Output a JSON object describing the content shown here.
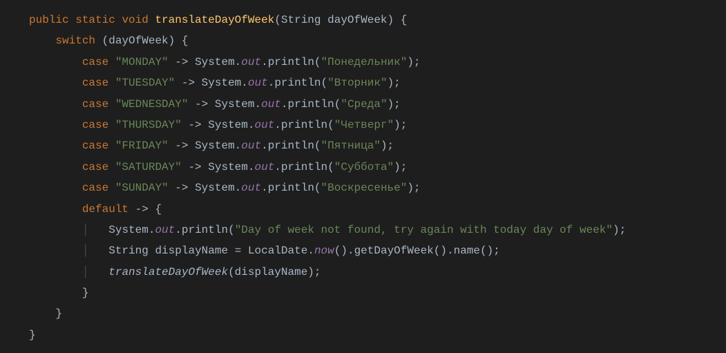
{
  "tok": {
    "public": "public",
    "static": "static",
    "void": "void",
    "methodName": "translateDayOfWeek",
    "String": "String",
    "param": "dayOfWeek",
    "switch": "switch",
    "case": "case",
    "default": "default",
    "System": "System",
    "out": "out",
    "println": "println",
    "LocalDate": "LocalDate",
    "now": "now",
    "getDayOfWeek": "getDayOfWeek",
    "name": "name",
    "displayName": "displayName",
    "arrow": "->"
  },
  "cases": {
    "mon": {
      "key": "\"MONDAY\"",
      "val": "\"Понедельник\""
    },
    "tue": {
      "key": "\"TUESDAY\"",
      "val": "\"Вторник\""
    },
    "wed": {
      "key": "\"WEDNESDAY\"",
      "val": "\"Среда\""
    },
    "thu": {
      "key": "\"THURSDAY\"",
      "val": "\"Четверг\""
    },
    "fri": {
      "key": "\"FRIDAY\"",
      "val": "\"Пятница\""
    },
    "sat": {
      "key": "\"SATURDAY\"",
      "val": "\"Суббота\""
    },
    "sun": {
      "key": "\"SUNDAY\"",
      "val": "\"Воскресенье\""
    }
  },
  "defaultMsg": "\"Day of week not found, try again with today day of week\""
}
